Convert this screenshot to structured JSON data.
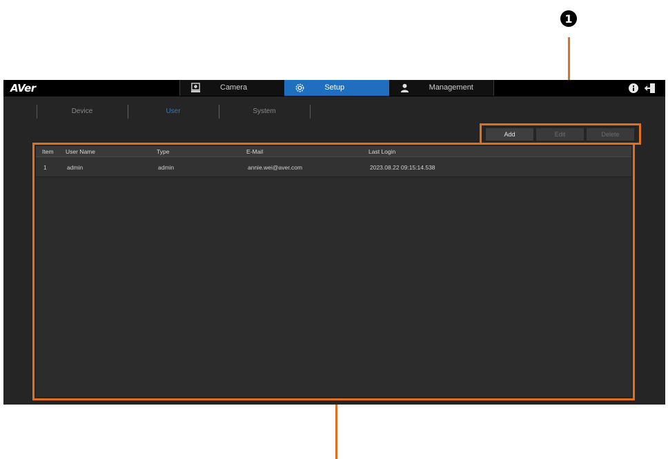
{
  "callout": {
    "number": "1"
  },
  "app": {
    "logo": "AVer",
    "main_tabs": [
      {
        "label": "Camera",
        "icon": "camera-icon"
      },
      {
        "label": "Setup",
        "icon": "gear-icon",
        "active": true
      },
      {
        "label": "Management",
        "icon": "user-icon"
      }
    ],
    "top_icons": [
      "info-icon",
      "logout-icon"
    ]
  },
  "sub_tabs": [
    {
      "label": "Device"
    },
    {
      "label": "User",
      "active": true
    },
    {
      "label": "System"
    }
  ],
  "actions": {
    "add_label": "Add",
    "edit_label": "Edit",
    "delete_label": "Delete"
  },
  "table": {
    "columns": [
      "Item",
      "User Name",
      "Type",
      "E-Mail",
      "Last Login"
    ],
    "rows": [
      [
        "1",
        "admin",
        "admin",
        "annie.wei@aver.com",
        "2023.08.22 09:15:14.538"
      ]
    ]
  },
  "colors": {
    "accent": "#1f6fc0",
    "highlight": "#e0701e",
    "background": "#252525"
  }
}
